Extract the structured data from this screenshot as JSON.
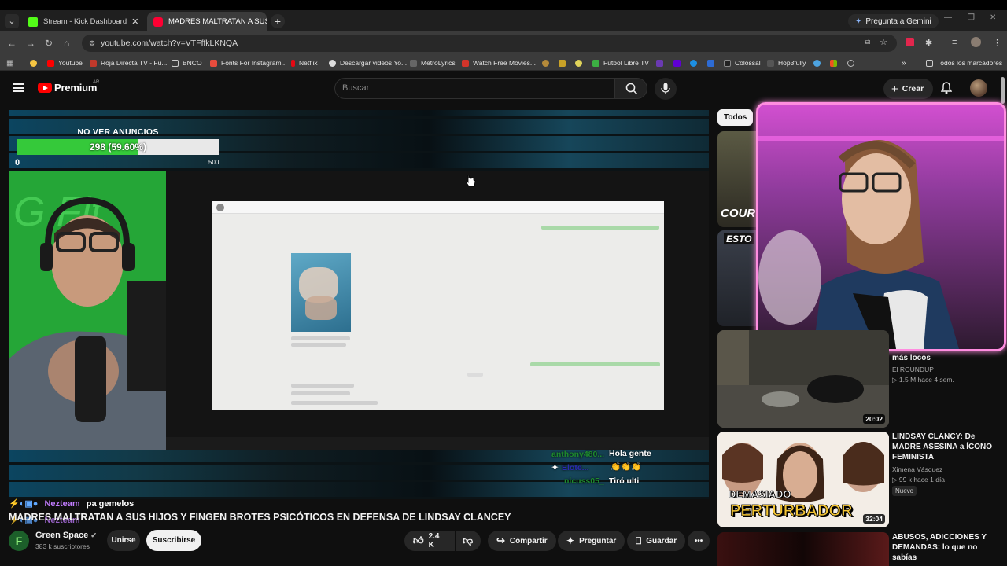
{
  "browser": {
    "tabs": [
      {
        "label": "Stream - Kick Dashboard",
        "favicon_color": "#53fc18"
      },
      {
        "label": "MADRES MALTRATAN A SUS H",
        "favicon_color": "#ff0033"
      }
    ],
    "gemini_label": "Pregunta a Gemini",
    "url": "youtube.com/watch?v=VTFffkLKNQA",
    "bookmarks": [
      {
        "label": "Youtube",
        "color": "#ff0000"
      },
      {
        "label": "Roja Directa TV - Fu...",
        "color": "#c0392b"
      },
      {
        "label": "BNCO",
        "color": "#7a7a7a"
      },
      {
        "label": "Fonts For Instagram...",
        "color": "#e84c3d"
      },
      {
        "label": "Netflix",
        "color": "#e50914"
      },
      {
        "label": "Descargar videos Yo...",
        "color": "#dddddd"
      },
      {
        "label": "MetroLyrics",
        "color": "#444444"
      },
      {
        "label": "Watch Free Movies...",
        "color": "#d2342a"
      },
      {
        "label": "Fútbol Libre TV",
        "color": "#3cb043"
      },
      {
        "label": "Colossal",
        "color": "#222222"
      },
      {
        "label": "Hop3fully",
        "color": "#555555"
      }
    ],
    "all_bookmarks_label": "Todos los marcadores"
  },
  "youtube": {
    "logo_text": "Premium",
    "country_code": "AR",
    "search_placeholder": "Buscar",
    "create_label": "Crear"
  },
  "stream_overlay": {
    "ad_goal_title": "NO VER ANUNCIOS",
    "ad_goal_count": "298 (59.60%)",
    "ad_goal_progress": 0.596,
    "ad_goal_min": "0",
    "ad_goal_max": "500",
    "chat": [
      {
        "user": "anthony480...",
        "message": "Hola gente",
        "user_color": "#1e8a2e"
      },
      {
        "user": "Elote...",
        "message": "",
        "user_color": "#2b2bb0"
      },
      {
        "user": "nicuss05_",
        "message": "Tiró ulti",
        "user_color": "#1e8a2e"
      }
    ],
    "bottom_user": "Nezteam",
    "bottom_message": "pa gemelos",
    "bottom_user2": "Nezteam"
  },
  "video": {
    "title": "MADRES MALTRATAN A SUS HIJOS Y FINGEN BROTES PSICÓTICOS EN DEFENSA DE LINDSAY CLANCEY",
    "channel": "Green Space",
    "subscribers": "383 k suscriptores",
    "join_label": "Unirse",
    "subscribe_label": "Suscribirse",
    "likes": "2.4 K",
    "share_label": "Compartir",
    "ask_label": "Preguntar",
    "save_label": "Guardar"
  },
  "sidebar": {
    "chip_label": "Todos",
    "items": [
      {
        "title": "más locos",
        "channel": "El ROUNDUP",
        "meta": "1.5 M  hace 4 sem.",
        "duration": "20:02"
      },
      {
        "title": "LINDSAY CLANCY: De MADRE ASESINA a ÍCONO FEMINISTA",
        "channel": "Ximena Vásquez",
        "meta": "99 k  hace 1 día",
        "badge": "Nuevo",
        "duration": "32:04",
        "thumb_text_1": "DEMASIADO",
        "thumb_text_2": "PERTURBADOR"
      },
      {
        "title": "ABUSOS, ADICCIONES Y DEMANDAS: lo que no sabías"
      }
    ],
    "thumb_court_text": "COURT",
    "thumb_esto_text": "ESTO"
  }
}
